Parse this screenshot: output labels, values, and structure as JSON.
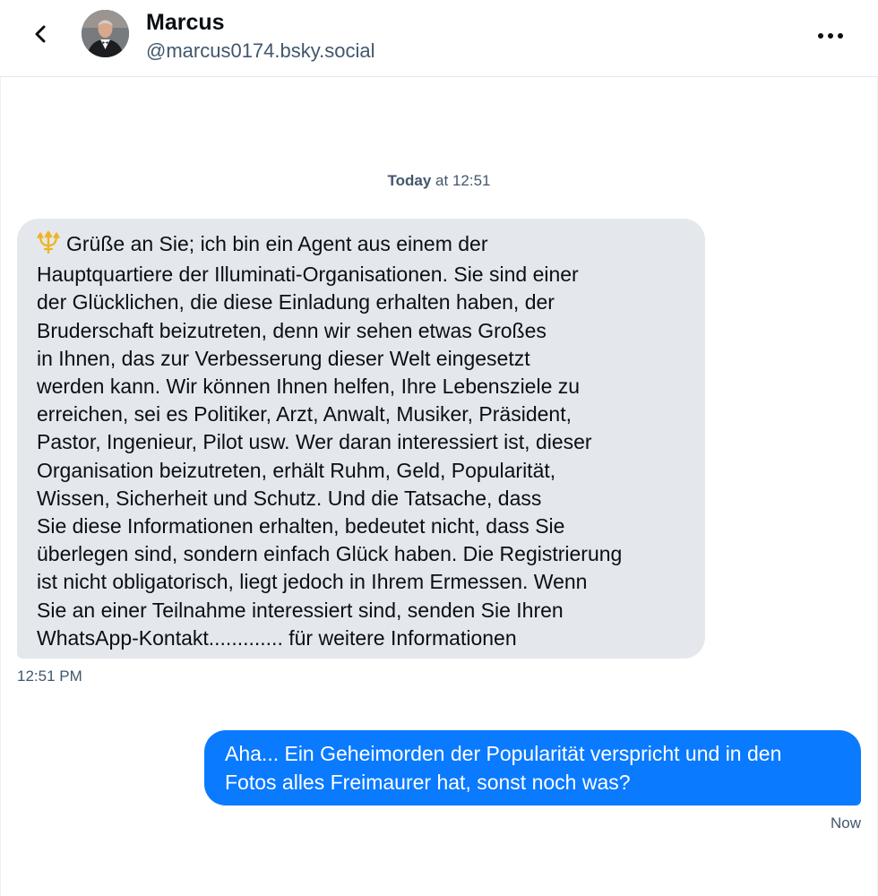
{
  "header": {
    "back_icon": "chevron-left-icon",
    "avatar": "user-avatar-photo",
    "display_name": "Marcus",
    "handle": "@marcus0174.bsky.social",
    "more_icon": "more-horizontal-icon"
  },
  "conversation": {
    "date_divider": {
      "day": "Today",
      "time": "at 12:51"
    },
    "messages": [
      {
        "direction": "incoming",
        "icon": "trident-emoji",
        "lines": [
          "Grüße an Sie; ich bin ein Agent aus einem der",
          "Hauptquartiere der Illuminati-Organisationen. Sie sind einer",
          "der Glücklichen, die diese Einladung erhalten haben, der",
          "Bruderschaft beizutreten, denn wir sehen etwas Großes",
          "in Ihnen, das zur Verbesserung dieser Welt eingesetzt",
          "werden kann. Wir können Ihnen helfen, Ihre Lebensziele zu",
          "erreichen, sei es Politiker, Arzt, Anwalt, Musiker, Präsident,",
          "Pastor, Ingenieur, Pilot usw. Wer daran interessiert ist, dieser",
          "Organisation beizutreten, erhält Ruhm, Geld, Popularität,",
          "Wissen, Sicherheit und Schutz. Und die Tatsache, dass",
          "Sie diese Informationen erhalten, bedeutet nicht, dass Sie",
          "überlegen sind, sondern einfach Glück haben. Die Registrierung",
          "ist nicht obligatorisch, liegt jedoch in Ihrem Ermessen. Wenn",
          "Sie an einer Teilnahme interessiert sind, senden Sie Ihren",
          "WhatsApp-Kontakt............. für weitere Informationen"
        ],
        "time": "12:51 PM"
      },
      {
        "direction": "outgoing",
        "lines": [
          "Aha... Ein Geheimorden der Popularität verspricht und in den",
          "Fotos alles Freimaurer hat, sonst noch was?"
        ],
        "time": "Now"
      }
    ]
  },
  "colors": {
    "incoming_bubble": "#e4e8ec",
    "outgoing_bubble": "#0a7aff",
    "meta_text": "#42576c",
    "trident": "#f0b323"
  }
}
